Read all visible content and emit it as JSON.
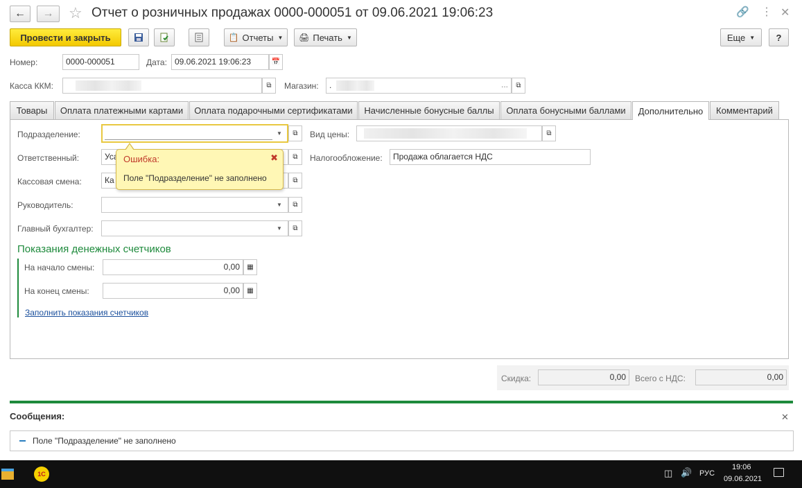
{
  "window": {
    "title": "Отчет о розничных продажах 0000-000051 от 09.06.2021 19:06:23"
  },
  "toolbar": {
    "post_close_label": "Провести и закрыть",
    "reports_label": "Отчеты",
    "print_label": "Печать",
    "more_label": "Еще",
    "help_label": "?"
  },
  "header": {
    "number_label": "Номер:",
    "number_value": "0000-000051",
    "date_label": "Дата:",
    "date_value": "09.06.2021 19:06:23",
    "kkm_label": "Касса ККМ:",
    "store_label": "Магазин:",
    "store_dots": "...",
    "store_prefix": "."
  },
  "tabs": [
    {
      "label": "Товары"
    },
    {
      "label": "Оплата платежными картами"
    },
    {
      "label": "Оплата подарочными сертификатами"
    },
    {
      "label": "Начисленные бонусные баллы"
    },
    {
      "label": "Оплата бонусными баллами"
    },
    {
      "label": "Дополнительно"
    },
    {
      "label": "Комментарий"
    }
  ],
  "form": {
    "division_label": "Подразделение:",
    "responsible_label": "Ответственный:",
    "responsible_value": "Уса",
    "shift_label": "Кассовая смена:",
    "shift_value": "Ка",
    "manager_label": "Руководитель:",
    "accountant_label": "Главный бухгалтер:",
    "price_type_label": "Вид цены:",
    "taxation_label": "Налогообложение:",
    "taxation_value": "Продажа облагается НДС"
  },
  "error_tooltip": {
    "title": "Ошибка:",
    "message": "Поле \"Подразделение\" не заполнено"
  },
  "counters": {
    "section_title": "Показания денежных счетчиков",
    "start_label": "На начало смены:",
    "start_value": "0,00",
    "end_label": "На конец смены:",
    "end_value": "0,00",
    "fill_link": "Заполнить показания счетчиков"
  },
  "totals": {
    "discount_label": "Скидка:",
    "discount_value": "0,00",
    "vat_total_label": "Всего с НДС:",
    "vat_total_value": "0,00"
  },
  "messages": {
    "title": "Сообщения:",
    "items": [
      "Поле \"Подразделение\" не заполнено"
    ]
  },
  "taskbar": {
    "language": "РУС",
    "time": "19:06",
    "date": "09.06.2021",
    "app_icon_label": "1С"
  },
  "colors": {
    "primary_button": "#f3c900",
    "section_green": "#1e8a3c",
    "link_blue": "#1a4f9c",
    "tooltip_bg": "#fff7b5",
    "error_title": "#c0392b"
  }
}
